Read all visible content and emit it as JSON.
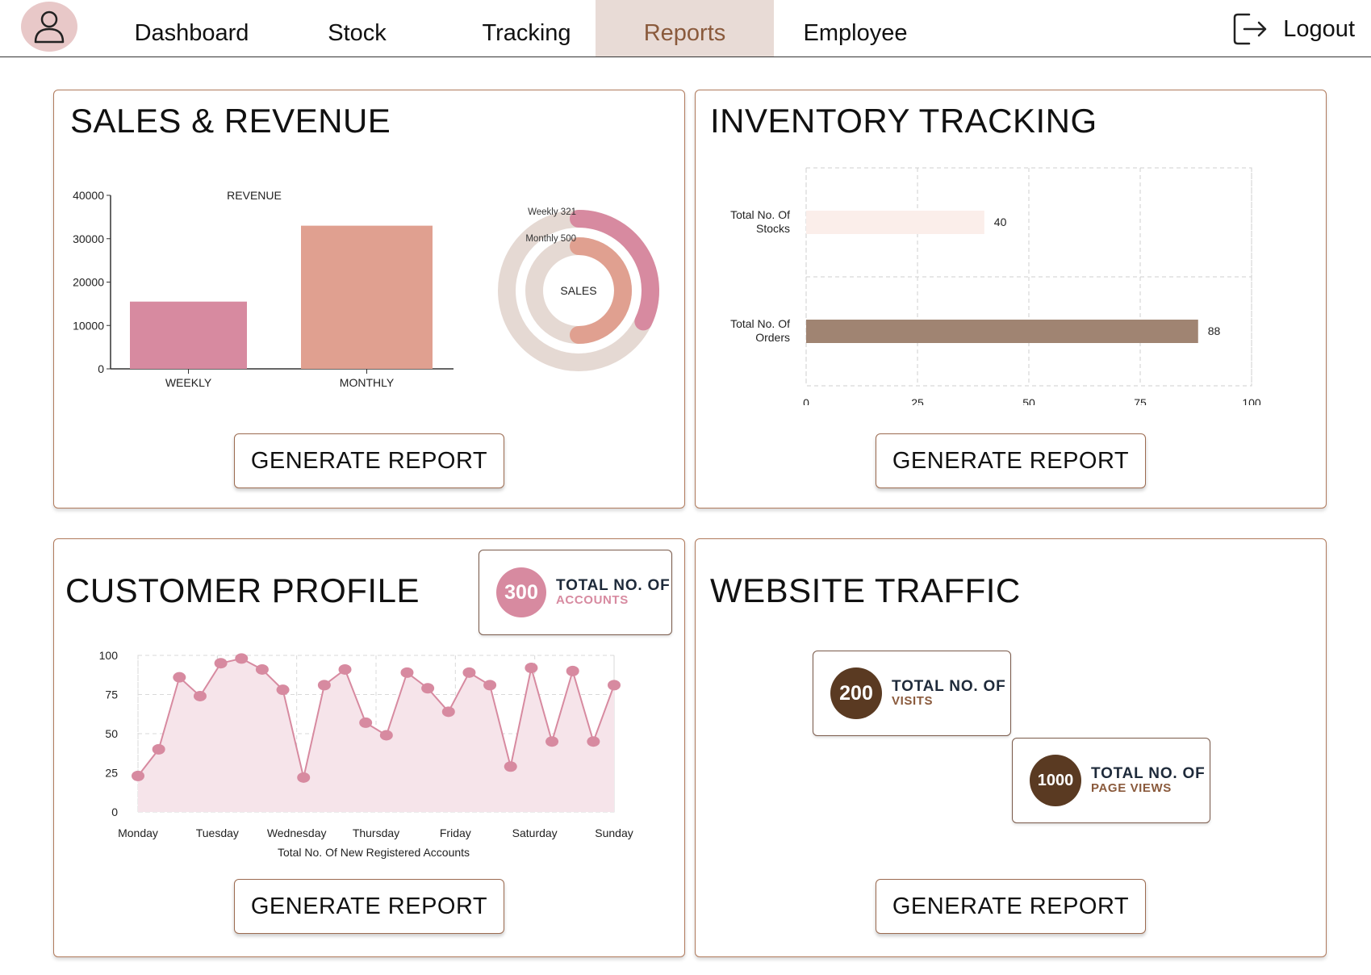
{
  "nav": {
    "items": [
      {
        "label": "Dashboard"
      },
      {
        "label": "Stock"
      },
      {
        "label": "Tracking"
      },
      {
        "label": "Reports",
        "active": true
      },
      {
        "label": "Employee"
      }
    ],
    "logout_label": "Logout"
  },
  "colors": {
    "accent": "#8a5a3c",
    "border": "#b07a5c",
    "pink": "#d78aa0",
    "salmon": "#e0a090",
    "brown": "#5a3a22",
    "taupe": "#a08472"
  },
  "sales": {
    "title": "SALES & REVENUE",
    "button": "GENERATE REPORT"
  },
  "inventory": {
    "title": "INVENTORY TRACKING",
    "button": "GENERATE REPORT"
  },
  "customer": {
    "title": "CUSTOMER PROFILE",
    "button": "GENERATE REPORT",
    "stat": {
      "value": "300",
      "line1": "TOTAL NO. OF",
      "line2": "ACCOUNTS"
    }
  },
  "traffic": {
    "title": "WEBSITE TRAFFIC",
    "button": "GENERATE REPORT",
    "visits": {
      "value": "200",
      "line1": "TOTAL NO. OF",
      "line2": "VISITS"
    },
    "pageviews": {
      "value": "1000",
      "line1": "TOTAL NO. OF",
      "line2": "PAGE VIEWS"
    }
  },
  "chart_data": [
    {
      "id": "revenue",
      "type": "bar",
      "title": "REVENUE",
      "categories": [
        "WEEKLY",
        "MONTHLY"
      ],
      "values": [
        15500,
        33000
      ],
      "ylim": [
        0,
        40000
      ],
      "yticks": [
        0,
        10000,
        20000,
        30000,
        40000
      ],
      "colors": [
        "#d78aa0",
        "#e0a090"
      ]
    },
    {
      "id": "sales",
      "type": "pie",
      "center_label": "SALES",
      "series": [
        {
          "name": "Weekly",
          "label": "Weekly 321",
          "value": 321,
          "color": "#d78aa0"
        },
        {
          "name": "Monthly",
          "label": "Monthly 500",
          "value": 500,
          "color": "#e0a090"
        }
      ],
      "max": 1000
    },
    {
      "id": "inventory",
      "type": "bar",
      "orientation": "horizontal",
      "categories": [
        "Total No. Of Stocks",
        "Total No. Of Orders"
      ],
      "values": [
        40,
        88
      ],
      "xlim": [
        0,
        100
      ],
      "xticks": [
        0,
        25,
        50,
        75,
        100
      ],
      "colors": [
        "#fbeeea",
        "#a08472"
      ],
      "grid": true
    },
    {
      "id": "accounts",
      "type": "area",
      "xlabel": "Total No. Of New Registered Accounts",
      "categories": [
        "Monday",
        "Tuesday",
        "Wednesday",
        "Thursday",
        "Friday",
        "Saturday",
        "Sunday"
      ],
      "values": [
        23,
        40,
        86,
        74,
        95,
        98,
        91,
        78,
        22,
        81,
        91,
        57,
        49,
        89,
        79,
        64,
        89,
        81,
        29,
        92,
        45,
        90,
        45,
        81
      ],
      "ylim": [
        0,
        100
      ],
      "yticks": [
        0,
        25,
        50,
        75,
        100
      ],
      "color": "#d78aa0",
      "grid": true
    }
  ]
}
